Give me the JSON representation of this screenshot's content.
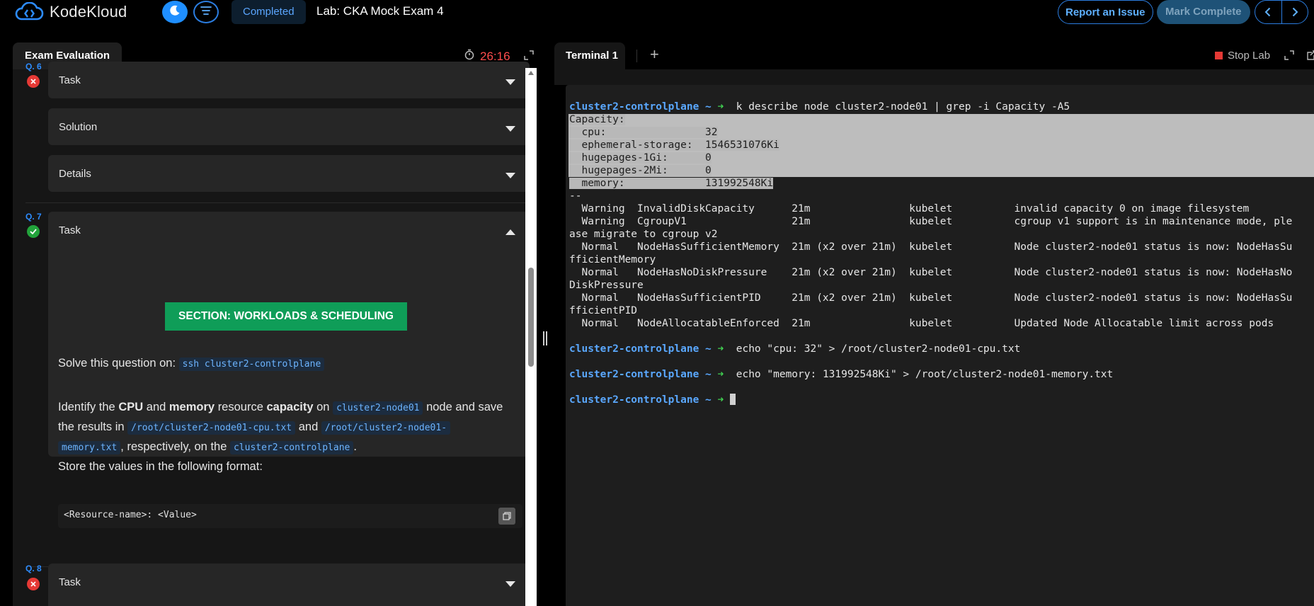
{
  "header": {
    "brand": "KodeKloud",
    "status": "Completed",
    "lab_title": "Lab: CKA Mock Exam 4",
    "report_label": "Report an Issue",
    "mark_complete_label": "Mark Complete"
  },
  "left": {
    "tab_label": "Exam Evaluation",
    "timer": "26:16",
    "q6": {
      "label": "Q. 6",
      "task": "Task",
      "solution": "Solution",
      "details": "Details"
    },
    "q7": {
      "label": "Q. 7",
      "task": "Task",
      "section": "SECTION: WORKLOADS & SCHEDULING",
      "solve_prefix": "Solve this question on:",
      "solve_host": "ssh cluster2-controlplane",
      "p_identify": "Identify the",
      "p_cpu": "CPU",
      "p_and1": "and",
      "p_memory": "memory",
      "p_resource": "resource",
      "p_capacity": "capacity",
      "p_on": "on",
      "p_node_code": "cluster2-node01",
      "p_node_save": "node and save",
      "p_results_in": "the results in",
      "p_cpu_file": "/root/cluster2-node01-cpu.txt",
      "p_and2": "and",
      "p_mem_file_1": "/root/cluster2-node01-",
      "p_mem_file_2": "memory.txt",
      "p_respectively": ", respectively, on the",
      "p_cp_code": "cluster2-controlplane",
      "p_period": ".",
      "store_line": "Store the values in the following format:",
      "format": "<Resource-name>: <Value>"
    },
    "q8": {
      "label": "Q. 8",
      "task": "Task"
    }
  },
  "right": {
    "tab_label": "Terminal 1",
    "add_tab": "+",
    "stop_lab": "Stop Lab",
    "prompt_host": "cluster2-controlplane ~",
    "prompt_arrow": "➜",
    "cmd1": " k describe node cluster2-node01 | grep -i Capacity -A5",
    "cap_lines": [
      "Capacity:",
      "  cpu:                32",
      "  ephemeral-storage:  1546531076Ki",
      "  hugepages-1Gi:      0",
      "  hugepages-2Mi:      0",
      "  memory:             131992548Ki"
    ],
    "event_lines": [
      "--",
      "  Warning  InvalidDiskCapacity      21m                kubelet          invalid capacity 0 on image filesystem",
      "  Warning  CgroupV1                 21m                kubelet          cgroup v1 support is in maintenance mode, ple",
      "ase migrate to cgroup v2",
      "  Normal   NodeHasSufficientMemory  21m (x2 over 21m)  kubelet          Node cluster2-node01 status is now: NodeHasSu",
      "fficientMemory",
      "  Normal   NodeHasNoDiskPressure    21m (x2 over 21m)  kubelet          Node cluster2-node01 status is now: NodeHasNo",
      "DiskPressure",
      "  Normal   NodeHasSufficientPID     21m (x2 over 21m)  kubelet          Node cluster2-node01 status is now: NodeHasSu",
      "fficientPID",
      "  Normal   NodeAllocatableEnforced  21m                kubelet          Updated Node Allocatable limit across pods"
    ],
    "cmd2": " echo \"cpu: 32\" > /root/cluster2-node01-cpu.txt",
    "cmd3": " echo \"memory: 131992548Ki\" > /root/cluster2-node01-memory.txt"
  }
}
